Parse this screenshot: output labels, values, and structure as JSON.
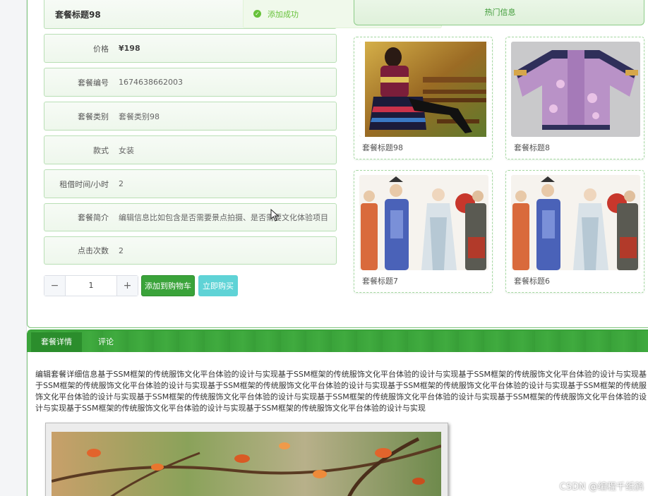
{
  "product": {
    "title": "套餐标题98",
    "fields": [
      {
        "label": "价格",
        "value": "¥198"
      },
      {
        "label": "套餐编号",
        "value": "1674638662003"
      },
      {
        "label": "套餐类别",
        "value": "套餐类别98"
      },
      {
        "label": "款式",
        "value": "女装"
      },
      {
        "label": "租借时间/小时",
        "value": "2"
      },
      {
        "label": "套餐简介",
        "value": "编辑信息比如包含是否需要景点拍摄、是否需要文化体验项目"
      },
      {
        "label": "点击次数",
        "value": "2"
      }
    ],
    "quantity": "1",
    "minus_symbol": "−",
    "plus_symbol": "+",
    "add_to_cart_label": "添加到购物车",
    "buy_now_label": "立即购买"
  },
  "toast": {
    "message": "添加成功",
    "icon": "check-circle-icon"
  },
  "hot": {
    "tab_label": "热门信息",
    "items": [
      {
        "title": "套餐标题98"
      },
      {
        "title": "套餐标题8"
      },
      {
        "title": "套餐标题7"
      },
      {
        "title": "套餐标题6"
      }
    ]
  },
  "detail": {
    "tabs": [
      "套餐详情",
      "评论"
    ],
    "text": "编辑套餐详细信息基于SSM框架的传统服饰文化平台体验的设计与实现基于SSM框架的传统服饰文化平台体验的设计与实现基于SSM框架的传统服饰文化平台体验的设计与实现基于SSM框架的传统服饰文化平台体验的设计与实现基于SSM框架的传统服饰文化平台体验的设计与实现基于SSM框架的传统服饰文化平台体验的设计与实现基于SSM框架的传统服饰文化平台体验的设计与实现基于SSM框架的传统服饰文化平台体验的设计与实现基于SSM框架的传统服饰文化平台体验的设计与实现基于SSM框架的传统服饰文化平台体验的设计与实现基于SSM框架的传统服饰文化平台体验的设计与实现基于SSM框架的传统服饰文化平台体验的设计与实现"
  },
  "watermark": "CSDN @编程千纸鹤",
  "colors": {
    "accent": "#3aa33a",
    "success": "#67c23a",
    "buy": "#5fd3d6"
  }
}
